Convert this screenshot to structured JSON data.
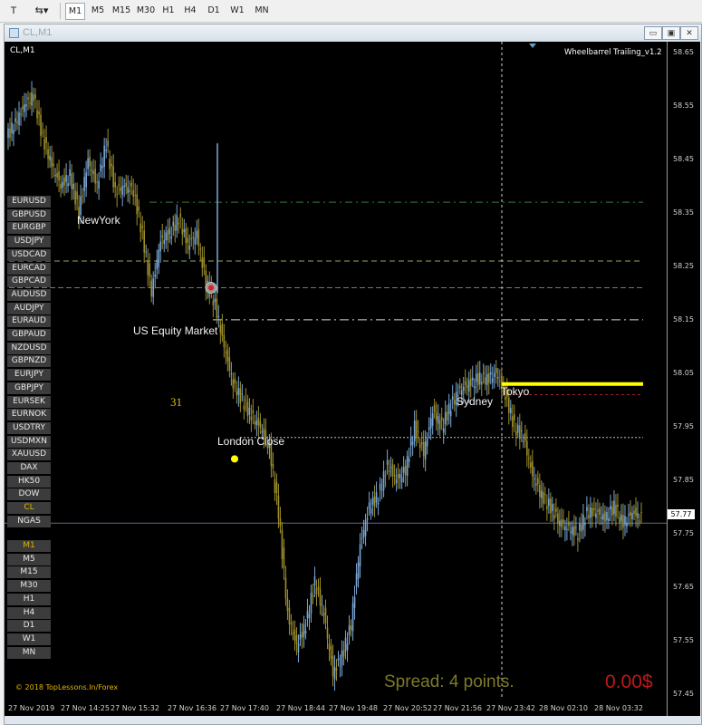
{
  "toolbar": {
    "timeframes": [
      "M1",
      "M5",
      "M15",
      "M30",
      "H1",
      "H4",
      "D1",
      "W1",
      "MN"
    ],
    "active_timeframe": "M1"
  },
  "window": {
    "title": "CL,M1",
    "min_btn": "▭",
    "restore_btn": "▣",
    "close_btn": "✕"
  },
  "chart": {
    "symbol_label": "CL,M1",
    "indicator_label": "Wheelbarrel Trailing_v1.2",
    "symbols": [
      "EURUSD",
      "GBPUSD",
      "EURGBP",
      "USDJPY",
      "USDCAD",
      "EURCAD",
      "GBPCAD",
      "AUDUSD",
      "AUDJPY",
      "EURAUD",
      "GBPAUD",
      "NZDUSD",
      "GBPNZD",
      "EURJPY",
      "GBPJPY",
      "EURSEK",
      "EURNOK",
      "USDTRY",
      "USDMXN",
      "XAUUSD",
      "DAX",
      "HK50",
      "DOW",
      "CL",
      "NGAS"
    ],
    "active_symbol": "CL",
    "timeframe_buttons": [
      "M1",
      "M5",
      "M15",
      "M30",
      "H1",
      "H4",
      "D1",
      "W1",
      "MN"
    ],
    "active_tf_button": "M1",
    "sessions": {
      "newyork": "NewYork",
      "us_equity": "US Equity Market",
      "london_close": "London Close",
      "sydney": "Sydney",
      "tokyo": "Tokyo"
    },
    "counter": "31",
    "copyright": "© 2018 TopLessons.In/Forex",
    "spread": "Spread: 4 points.",
    "profit": "0.00$",
    "current_price": "57.77",
    "price_labels": [
      "58.65",
      "58.55",
      "58.45",
      "58.35",
      "58.25",
      "58.15",
      "58.05",
      "57.95",
      "57.85",
      "57.75",
      "57.65",
      "57.55",
      "57.45"
    ],
    "time_labels": [
      "27 Nov 2019",
      "27 Nov 14:25",
      "27 Nov 15:32",
      "27 Nov 16:36",
      "27 Nov 17:40",
      "27 Nov 18:44",
      "27 Nov 19:48",
      "27 Nov 20:52",
      "27 Nov 21:56",
      "27 Nov 23:42",
      "28 Nov 02:10",
      "28 Nov 03:32"
    ],
    "colors": {
      "background": "#000000",
      "bull": "#7aa7d6",
      "bear": "#9e8f2a",
      "highlight": "#ffff00",
      "spread": "#7d7a2a",
      "profit": "#c01818"
    },
    "chart_data": {
      "type": "line",
      "title": "",
      "x": [
        0,
        10,
        20,
        30,
        40,
        50,
        60,
        70,
        80,
        90,
        100,
        110,
        120,
        130,
        140,
        150,
        160,
        170,
        180,
        190,
        200,
        210,
        220,
        230,
        240,
        250,
        260,
        270,
        280,
        290,
        300,
        310,
        320,
        330,
        340,
        350,
        360,
        370,
        380,
        390,
        400,
        410,
        420,
        430,
        440,
        450,
        460,
        470,
        480,
        490,
        500,
        510,
        520,
        530,
        540,
        550,
        560,
        570,
        580,
        590,
        600,
        610,
        620,
        630,
        640,
        650,
        660,
        670,
        680,
        690,
        700
      ],
      "series": [
        {
          "values": [
            58.49,
            58.52,
            58.55,
            58.57,
            58.49,
            58.44,
            58.4,
            58.42,
            58.35,
            58.45,
            58.4,
            58.48,
            58.39,
            58.4,
            58.39,
            58.31,
            58.2,
            58.3,
            58.31,
            58.34,
            58.29,
            58.31,
            58.22,
            58.18,
            58.1,
            58.03,
            58.0,
            57.97,
            57.95,
            57.91,
            57.79,
            57.6,
            57.54,
            57.58,
            57.66,
            57.6,
            57.49,
            57.52,
            57.58,
            57.73,
            57.8,
            57.82,
            57.88,
            57.85,
            57.87,
            57.95,
            57.9,
            57.98,
            57.95,
            57.99,
            58.02,
            58.03,
            58.04,
            58.04,
            58.05,
            58.01,
            57.95,
            57.93,
            57.86,
            57.82,
            57.8,
            57.77,
            57.76,
            57.75,
            57.79,
            57.79,
            57.78,
            57.8,
            57.77,
            57.79,
            57.78
          ]
        }
      ],
      "ylim": [
        57.44,
        58.67
      ],
      "xlabel": "",
      "ylabel": ""
    }
  }
}
